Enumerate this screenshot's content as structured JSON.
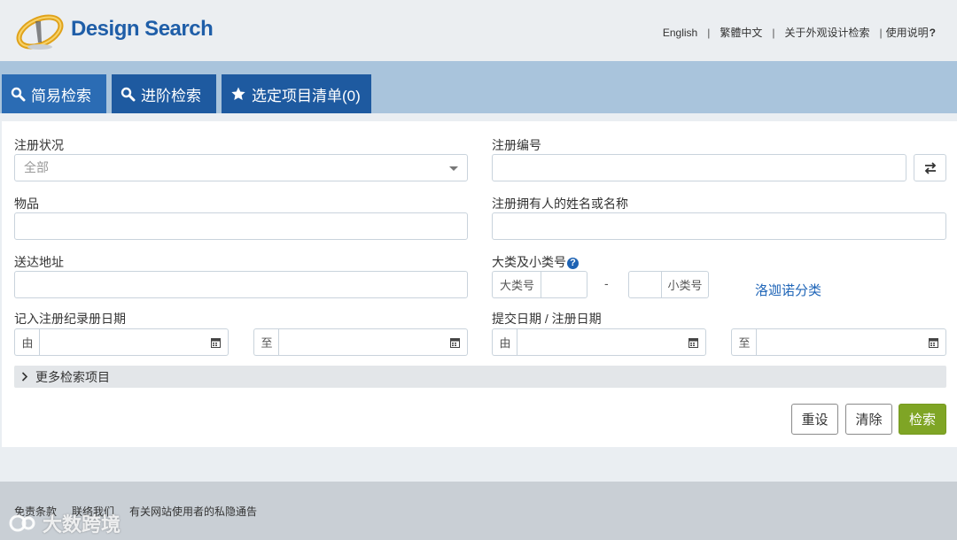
{
  "header": {
    "logo_text": "Design Search",
    "links": [
      "English",
      "繁體中文",
      "关于外观设计检索",
      "使用说明"
    ],
    "help_mark": "?"
  },
  "tabs": [
    {
      "label": "简易检索",
      "icon": "search-icon"
    },
    {
      "label": "进阶检索",
      "icon": "search-icon"
    },
    {
      "label": "选定项目清单(0)",
      "icon": "star-icon"
    }
  ],
  "form": {
    "status": {
      "label": "注册状况",
      "value": "全部"
    },
    "reg_no": {
      "label": "注册编号",
      "value": ""
    },
    "article": {
      "label": "物品",
      "value": ""
    },
    "owner": {
      "label": "注册拥有人的姓名或名称",
      "value": ""
    },
    "address": {
      "label": "送达地址",
      "value": ""
    },
    "classification": {
      "label": "大类及小类号",
      "class_label": "大类号",
      "separator": "-",
      "subclass_label": "小类号",
      "link": "洛迦诺分类"
    },
    "entry_date": {
      "label": "记入注册纪录册日期",
      "from": "由",
      "to": "至"
    },
    "filing_date": {
      "label": "提交日期 / 注册日期",
      "from": "由",
      "to": "至"
    },
    "more": "更多检索项目"
  },
  "buttons": {
    "reset": "重设",
    "clear": "清除",
    "search": "检索"
  },
  "footer": {
    "links": [
      "免责条款",
      "联络我们",
      "有关网站使用者的私隐通告"
    ],
    "watermark": "大数跨境"
  },
  "colors": {
    "brand_blue": "#1e5aa0",
    "tab_bar": "#a9c4dc",
    "search_green": "#7fa525",
    "link_blue": "#2066b8"
  }
}
